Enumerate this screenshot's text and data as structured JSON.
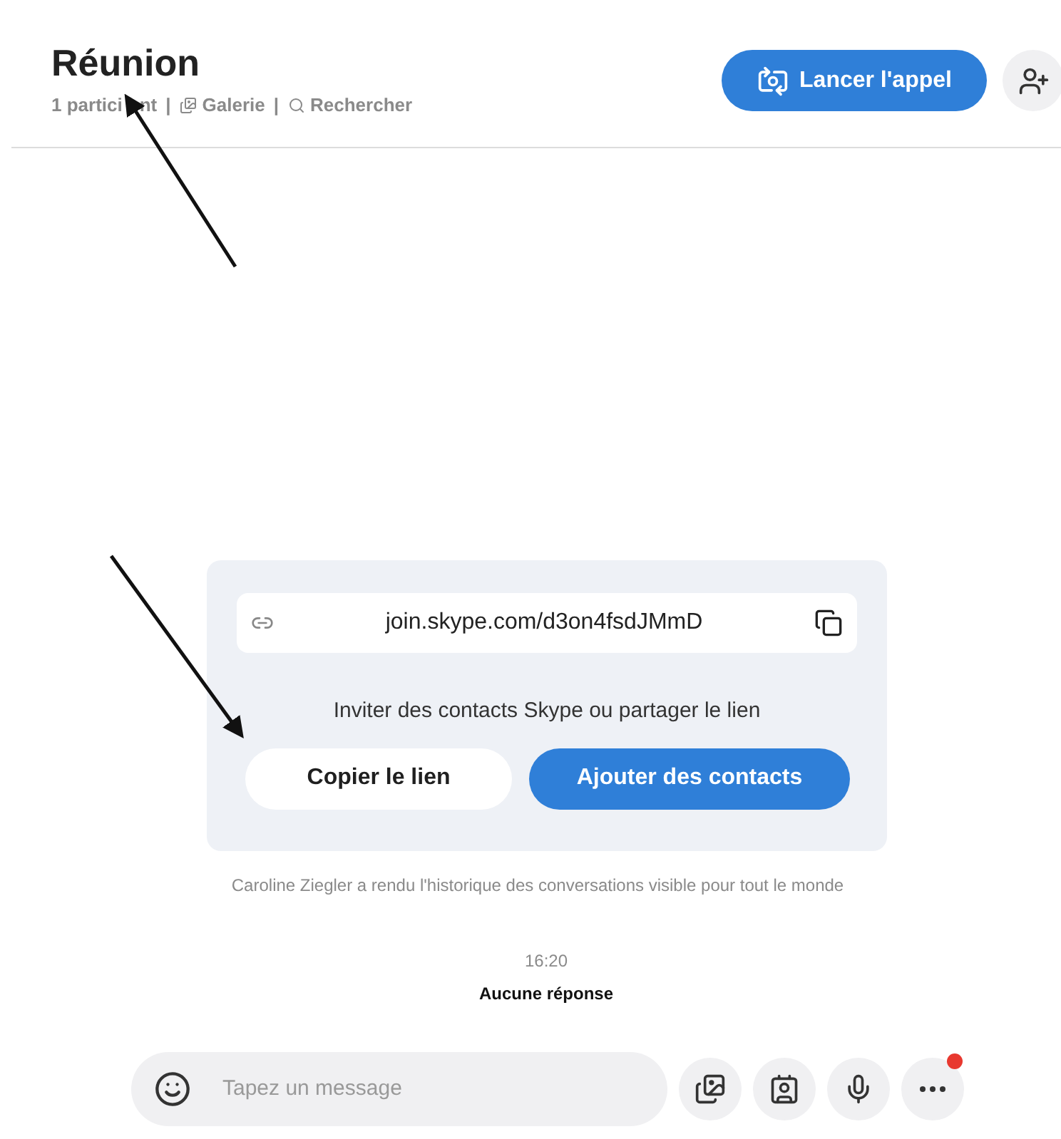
{
  "header": {
    "title": "Réunion",
    "participants": [
      "1 partici",
      "nt"
    ],
    "separator": "|",
    "gallery": "Galerie",
    "search": "Rechercher",
    "call_button": "Lancer l'appel"
  },
  "invite_card": {
    "link": "join.skype.com/d3on4fsdJMmD",
    "prompt": "Inviter des contacts Skype ou partager le lien",
    "buttons": [
      {
        "label": "Copier le lien",
        "kind": "secondary"
      },
      {
        "label": "Ajouter des contacts",
        "kind": "primary"
      }
    ]
  },
  "messages": {
    "notice": "Caroline Ziegler a rendu l'historique des conversations visible pour tout le monde",
    "time": "16:20",
    "status": "Aucune réponse"
  },
  "composer": {
    "placeholder": "Tapez un message",
    "more_badge": true
  }
}
